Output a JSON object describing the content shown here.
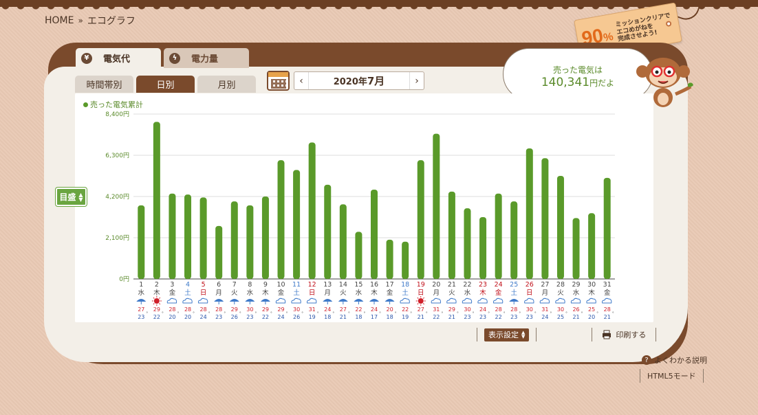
{
  "breadcrumb": {
    "home": "HOME",
    "sep": "»",
    "current": "エコグラフ"
  },
  "badge": {
    "percent": "90",
    "percent_unit": "%",
    "line1": "ミッションクリアで",
    "line2": "エコめがねを",
    "line3": "完成させよう!"
  },
  "tabs": {
    "electricity_cost": "電気代",
    "electricity_amount": "電力量"
  },
  "subtabs": {
    "hourly": "時間帯別",
    "daily": "日別",
    "monthly": "月別"
  },
  "month_nav": {
    "prev": "‹",
    "next": "›",
    "year_label": "2020年",
    "month_label": "7月"
  },
  "speech": {
    "line1": "売った電気は",
    "amount": "140,341",
    "suffix": "円だよ"
  },
  "legend": "売った電気累計",
  "yaxis_button": "目盛",
  "bottom": {
    "display_settings": "表示設定",
    "print": "印刷する",
    "help": "よくわかる説明",
    "html5": "HTML5モード"
  },
  "colors": {
    "bar": "#5a9a2a",
    "sat": "#3f7ac9",
    "sun": "#c0101a",
    "grid": "#dddddd"
  },
  "chart_data": {
    "type": "bar",
    "series_name": "売った電気累計",
    "y_tick_labels": [
      "0円",
      "2,100円",
      "4,200円",
      "6,300円",
      "8,400円"
    ],
    "y_ticks": [
      0,
      2100,
      4200,
      6300,
      8400
    ],
    "ylim": [
      0,
      8400
    ],
    "days": [
      "1",
      "2",
      "3",
      "4",
      "5",
      "6",
      "7",
      "8",
      "9",
      "10",
      "11",
      "12",
      "13",
      "14",
      "15",
      "16",
      "17",
      "18",
      "19",
      "20",
      "21",
      "22",
      "23",
      "24",
      "25",
      "26",
      "27",
      "28",
      "29",
      "30",
      "31"
    ],
    "weekdays": [
      "水",
      "木",
      "金",
      "土",
      "日",
      "月",
      "火",
      "水",
      "木",
      "金",
      "土",
      "日",
      "月",
      "火",
      "水",
      "木",
      "金",
      "土",
      "日",
      "月",
      "火",
      "水",
      "木",
      "金",
      "土",
      "日",
      "月",
      "火",
      "水",
      "木",
      "金"
    ],
    "day_types": [
      "w",
      "w",
      "w",
      "sat",
      "sun",
      "w",
      "w",
      "w",
      "w",
      "w",
      "sat",
      "sun",
      "w",
      "w",
      "w",
      "w",
      "w",
      "sat",
      "sun",
      "w",
      "w",
      "w",
      "sun",
      "sun",
      "sat",
      "sun",
      "w",
      "w",
      "w",
      "w",
      "w"
    ],
    "values": [
      3750,
      8000,
      4350,
      4300,
      4150,
      2700,
      3950,
      3750,
      4200,
      6050,
      5550,
      6950,
      4800,
      3800,
      2400,
      4550,
      2000,
      1900,
      6050,
      7400,
      4450,
      3600,
      3150,
      4350,
      3950,
      6650,
      6150,
      5250,
      3100,
      3350,
      5150
    ],
    "weather": [
      "rain",
      "sun",
      "cloud",
      "cloud",
      "cloud",
      "rain",
      "rain",
      "rain",
      "rain",
      "cloud",
      "cloud",
      "cloud",
      "rain",
      "rain",
      "rain",
      "rain",
      "rain",
      "cloud",
      "sun",
      "cloud",
      "cloud",
      "cloud",
      "cloud",
      "cloud",
      "rain",
      "cloud",
      "cloud",
      "cloud",
      "cloud",
      "cloud",
      "cloud"
    ],
    "high_temps": [
      "27",
      "29",
      "28",
      "28",
      "28",
      "28",
      "29",
      "30",
      "29",
      "29",
      "30",
      "31",
      "24",
      "27",
      "22",
      "24",
      "20",
      "22",
      "27",
      "31",
      "29",
      "30",
      "24",
      "28",
      "28",
      "30",
      "31",
      "30",
      "26",
      "25",
      "28"
    ],
    "low_temps": [
      "23",
      "22",
      "20",
      "20",
      "24",
      "23",
      "26",
      "23",
      "22",
      "24",
      "26",
      "19",
      "18",
      "21",
      "18",
      "17",
      "18",
      "19",
      "21",
      "22",
      "21",
      "23",
      "23",
      "22",
      "23",
      "23",
      "24",
      "25",
      "21",
      "20",
      "21"
    ],
    "temp_unit": "°"
  }
}
